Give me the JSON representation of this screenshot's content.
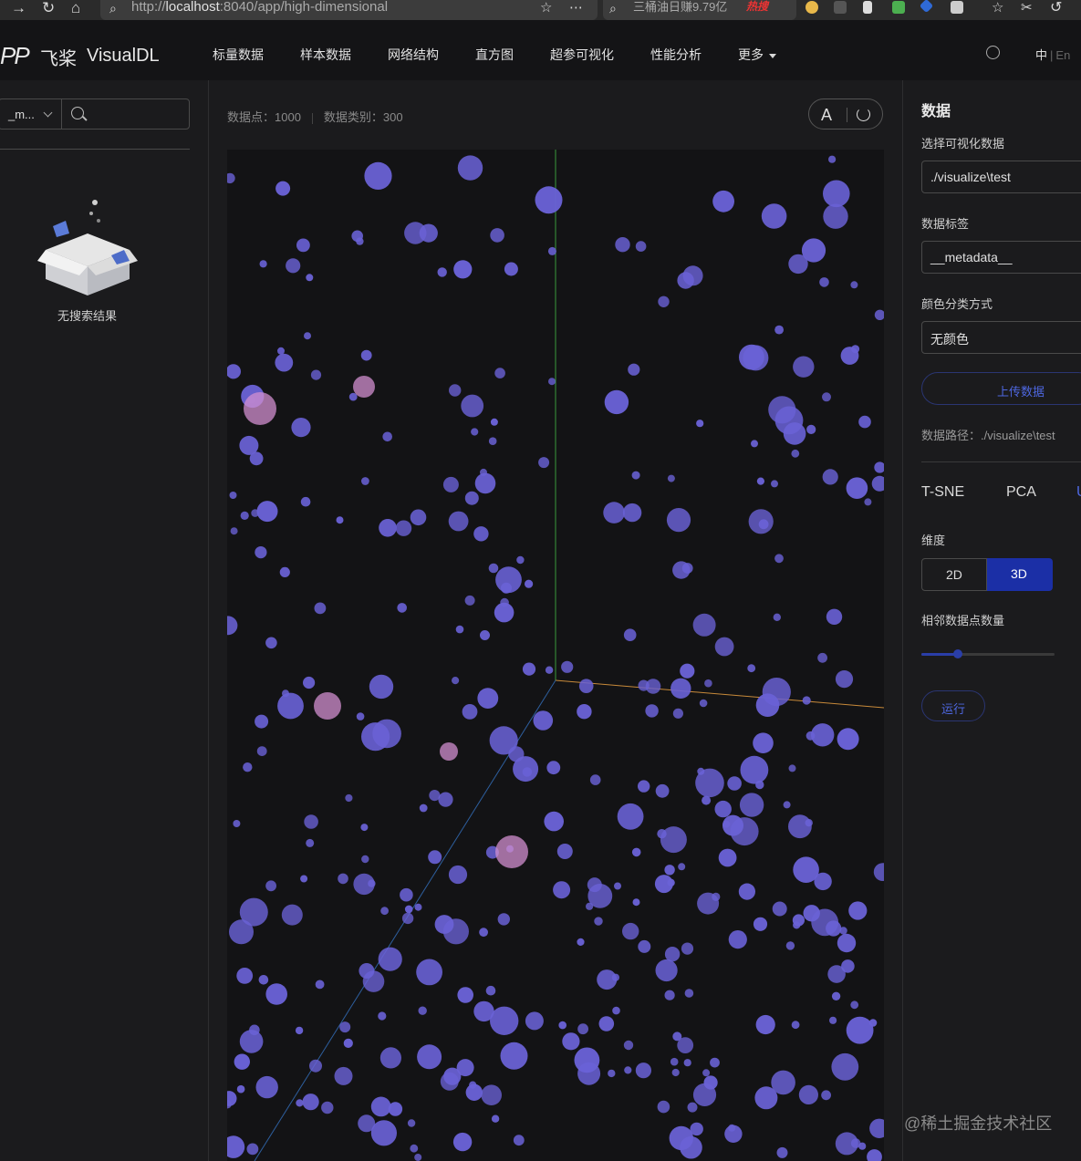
{
  "browser": {
    "url_prefix": "http://",
    "url_host": "localhost",
    "url_rest": ":8040/app/high-dimensional",
    "search_text": "三桶油日赚9.79亿",
    "hot_badge": "热搜"
  },
  "header": {
    "logo_mark": "PP",
    "logo_cn": "飞桨",
    "logo_en": "VisualDL",
    "menu": [
      "标量数据",
      "样本数据",
      "网络结构",
      "直方图",
      "超参可视化",
      "性能分析",
      "更多"
    ],
    "lang_zh": "中",
    "lang_en": "En"
  },
  "left_panel": {
    "select_value": "_m...",
    "search_placeholder": "",
    "empty_text": "无搜索结果"
  },
  "center": {
    "points_label": "数据点：1000",
    "categories_label": "数据类别：300",
    "label_toggle": "A"
  },
  "right_panel": {
    "title": "数据",
    "select_data_label": "选择可视化数据",
    "select_data_value": "./visualize\\test",
    "data_label_label": "数据标签",
    "data_label_value": "__metadata__",
    "color_label": "颜色分类方式",
    "color_value": "无颜色",
    "upload_button": "上传数据",
    "path": "数据路径：./visualize\\test",
    "tabs": [
      "T-SNE",
      "PCA",
      "U"
    ],
    "dimension_label": "维度",
    "dim_2d": "2D",
    "dim_3d": "3D",
    "neighbors_label": "相邻数据点数量",
    "neighbors_fraction": 0.27,
    "run_button": "运行"
  },
  "watermark": "@稀土掘金技术社区",
  "colors": {
    "point": "#6a62d6",
    "highlight_point": "#d28fcf",
    "axis_y": "#3a9a3a",
    "axis_x": "#c88a3a",
    "axis_z": "#2e5f9e",
    "accent": "#1b2fa6"
  }
}
